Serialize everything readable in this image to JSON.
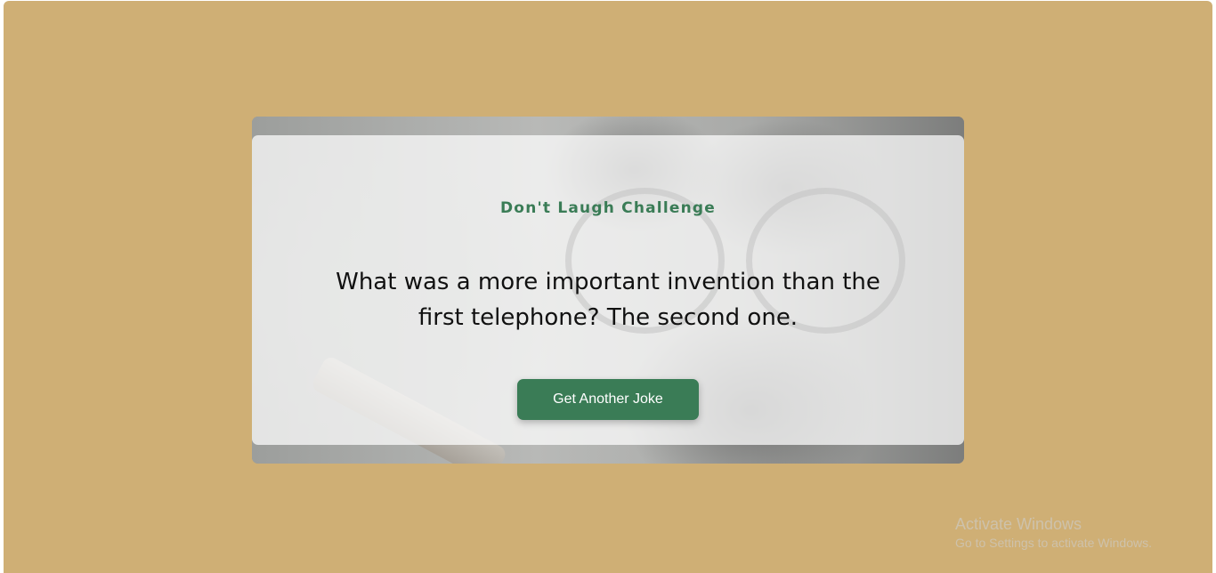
{
  "card": {
    "title": "Don't Laugh Challenge",
    "joke": "What was a more important invention than the first telephone? The second one.",
    "button_label": "Get Another Joke"
  },
  "watermark": {
    "title": "Activate Windows",
    "subtitle": "Go to Settings to activate Windows."
  },
  "colors": {
    "page_background": "#cfaf75",
    "accent": "#3a7c56",
    "button_text": "#ffffff"
  }
}
